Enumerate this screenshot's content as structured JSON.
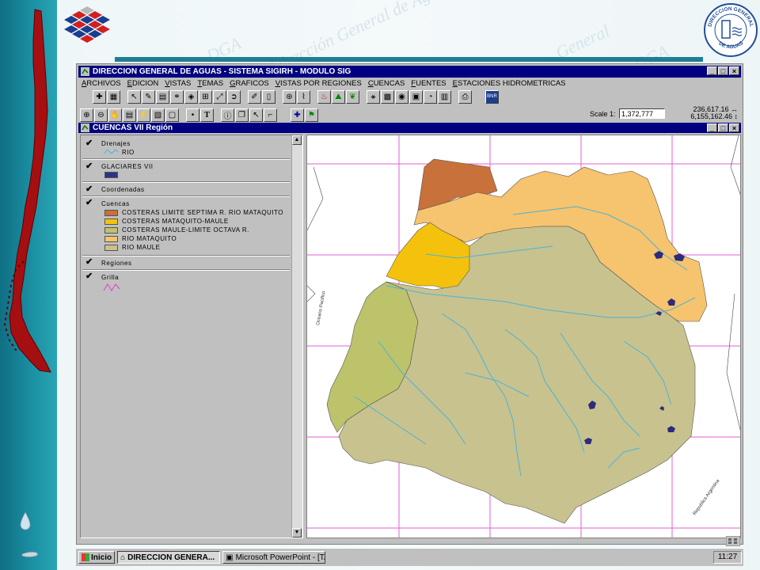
{
  "app": {
    "title": "DIRECCION GENERAL DE AGUAS - SISTEMA SIGIRH - MODULO SIG",
    "menu": [
      "ARCHIVOS",
      "EDICION",
      "VISTAS",
      "TEMAS",
      "GRAFICOS",
      "VISTAS POR REGIONES",
      "CUENCAS",
      "FUENTES",
      "ESTACIONES HIDROMETRICAS"
    ],
    "scale_label": "Scale 1:",
    "scale_value": "1,372,777",
    "coord_x": "236,617.16",
    "coord_y": "6,155,162.46",
    "window_buttons": [
      "_",
      "□",
      "×"
    ]
  },
  "view": {
    "title": "CUENCAS VII Región",
    "layers": {
      "drenajes": {
        "label": "Drenajes",
        "sub": "RIO"
      },
      "glaciares": {
        "label": "GLACIARES VII"
      },
      "coordenadas": {
        "label": "Coordenadas"
      },
      "cuencas": {
        "label": "Cuencas",
        "items": [
          {
            "label": "COSTERAS LIMITE SEPTIMA R. RIO MATAQUITO",
            "color": "#c8713a"
          },
          {
            "label": "COSTERAS MATAQUITO-MAULE",
            "color": "#f4c20d"
          },
          {
            "label": "COSTERAS MAULE-LIMITE OCTAVA R.",
            "color": "#bdc36a"
          },
          {
            "label": "RIO MATAQUITO",
            "color": "#f6c36e"
          },
          {
            "label": "RIO MAULE",
            "color": "#c8c28f"
          }
        ]
      },
      "regiones": {
        "label": "Regiones"
      },
      "grilla": {
        "label": "Grilla"
      }
    },
    "map_labels": [
      "Oceano Pacifico",
      "Republica Argentina"
    ]
  },
  "taskbar": {
    "start": "Inicio",
    "tasks": [
      "DIRECCION GENERA...",
      "Microsoft PowerPoint - [TA..."
    ],
    "clock": "11:27"
  },
  "watermarks": [
    "Dirección General de Aguas",
    "General",
    "DGA"
  ],
  "seal_text": {
    "top": "DIRECCION GENERAL",
    "bottom": "DE AGUAS"
  }
}
